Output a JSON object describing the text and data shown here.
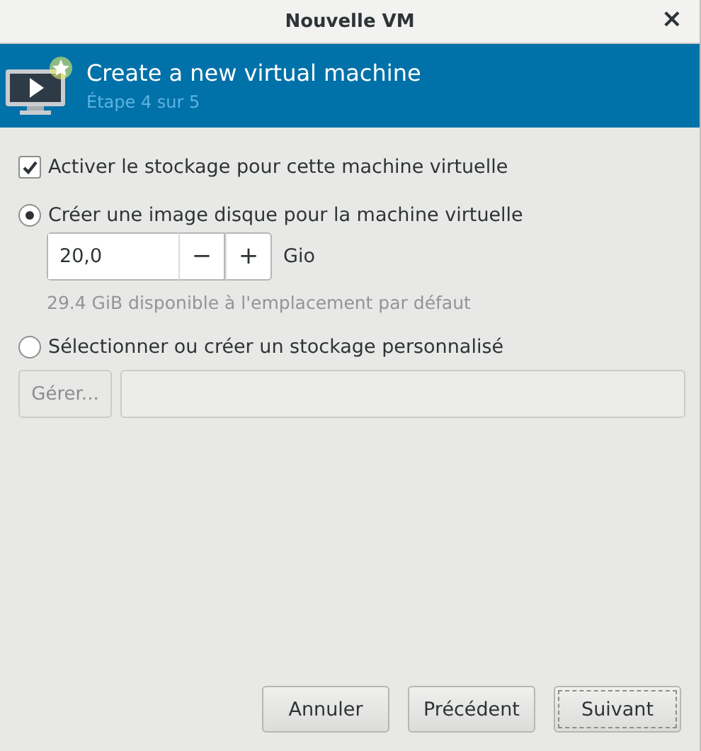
{
  "window": {
    "title": "Nouvelle VM",
    "close": "×"
  },
  "header": {
    "title": "Create a new virtual machine",
    "subtitle": "Étape 4 sur 5"
  },
  "enable_storage": {
    "label": "Activer le stockage pour cette machine virtuelle",
    "checked": true
  },
  "options": [
    {
      "kind": "create",
      "label": "Créer une image disque pour la machine virtuelle",
      "selected": true,
      "size": {
        "value": "20,0",
        "decrement": "−",
        "increment": "+",
        "unit": "Gio"
      },
      "hint": "29.4 GiB disponible à l'emplacement par défaut"
    },
    {
      "kind": "custom",
      "label": "Sélectionner ou créer un stockage personnalisé",
      "selected": false,
      "manage_button": {
        "label": "Gérer...",
        "disabled": true
      },
      "path_field": {
        "disabled": true
      }
    }
  ],
  "buttons": [
    {
      "label": "Annuler",
      "focused": false
    },
    {
      "label": "Précédent",
      "focused": false
    },
    {
      "label": "Suivant",
      "focused": true
    }
  ]
}
